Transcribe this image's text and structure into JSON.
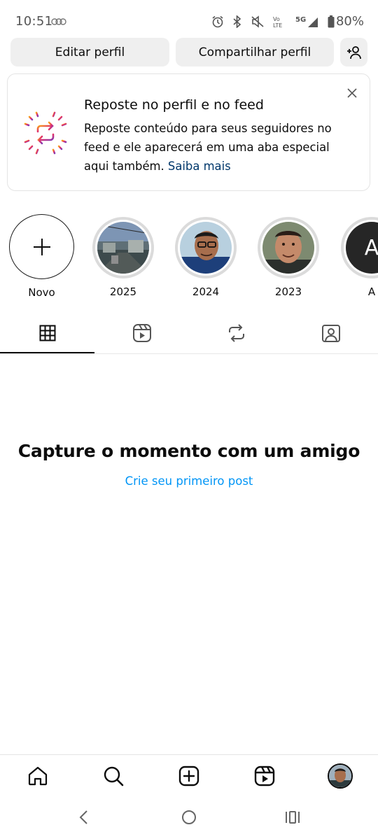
{
  "status_bar": {
    "time": "10:51",
    "battery": "80%",
    "icons": [
      "alarm-icon",
      "bluetooth-icon",
      "mute-icon",
      "volte-icon",
      "5g-icon",
      "signal-icon",
      "battery-icon"
    ]
  },
  "actions": {
    "edit_profile": "Editar perfil",
    "share_profile": "Compartilhar perfil",
    "add_user_icon": "add-person-icon"
  },
  "repost_card": {
    "title": "Reposte no perfil e no feed",
    "body": "Reposte conteúdo para seus seguidores no feed e ele aparecerá em uma aba especial aqui também.",
    "link": "Saiba mais"
  },
  "highlights": [
    {
      "label": "Novo"
    },
    {
      "label": "2025"
    },
    {
      "label": "2024"
    },
    {
      "label": "2023"
    },
    {
      "label": "A",
      "avatar_letter": "A"
    }
  ],
  "tabs": [
    {
      "icon": "grid-icon",
      "active": true
    },
    {
      "icon": "reels-icon",
      "active": false
    },
    {
      "icon": "repost-icon",
      "active": false
    },
    {
      "icon": "tagged-icon",
      "active": false
    }
  ],
  "empty_state": {
    "title": "Capture o momento com um amigo",
    "link": "Crie seu primeiro post"
  },
  "bottom_nav": [
    "home-icon",
    "search-icon",
    "create-icon",
    "reels-icon",
    "profile-avatar"
  ],
  "colors": {
    "link_blue": "#0095f6",
    "dark_link": "#00376b",
    "pill_bg": "#efefef",
    "text": "#0c0c0c"
  }
}
